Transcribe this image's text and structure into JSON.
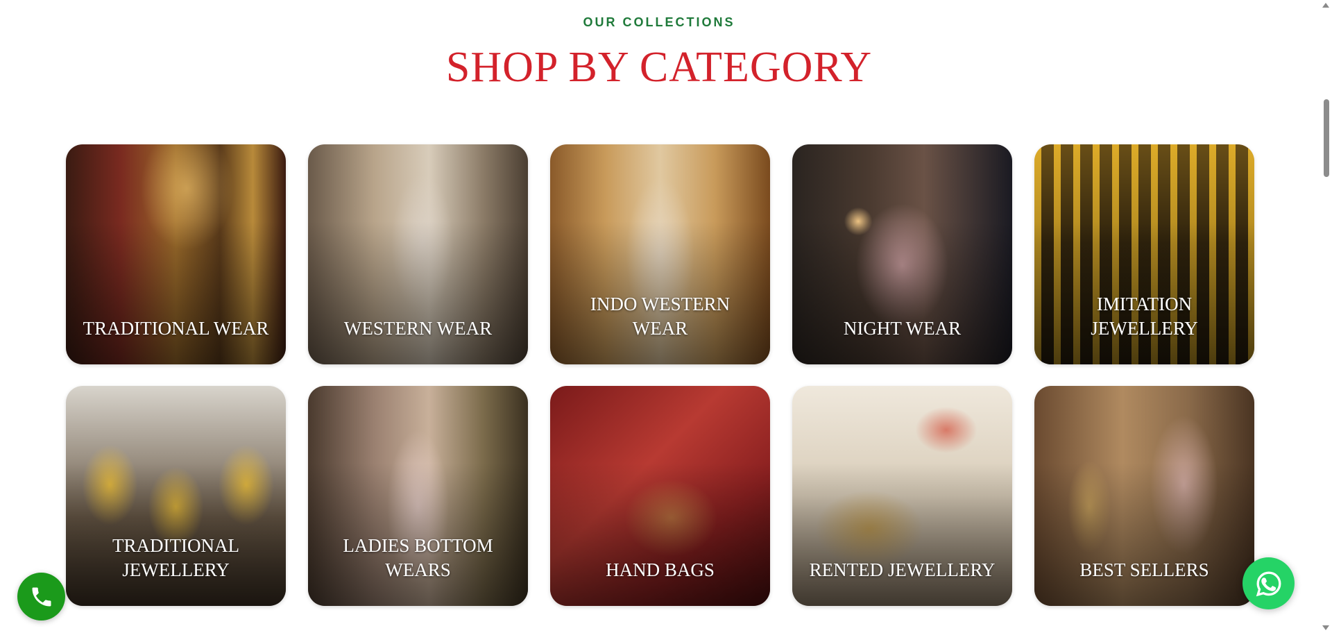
{
  "section": {
    "eyebrow": "OUR COLLECTIONS",
    "title": "SHOP BY CATEGORY"
  },
  "categories": [
    {
      "label": "TRADITIONAL WEAR"
    },
    {
      "label": "WESTERN WEAR"
    },
    {
      "label": "INDO WESTERN WEAR"
    },
    {
      "label": "NIGHT WEAR"
    },
    {
      "label": "IMITATION JEWELLERY"
    },
    {
      "label": "TRADITIONAL JEWELLERY"
    },
    {
      "label": "LADIES BOTTOM WEARS"
    },
    {
      "label": "HAND BAGS"
    },
    {
      "label": "RENTED JEWELLERY"
    },
    {
      "label": "BEST SELLERS"
    }
  ],
  "floating": {
    "call_icon": "phone-icon",
    "whatsapp_icon": "whatsapp-icon"
  },
  "colors": {
    "eyebrow": "#1f7a3a",
    "title": "#d3222b",
    "call": "#1b9a1b",
    "whatsapp": "#25d366"
  }
}
